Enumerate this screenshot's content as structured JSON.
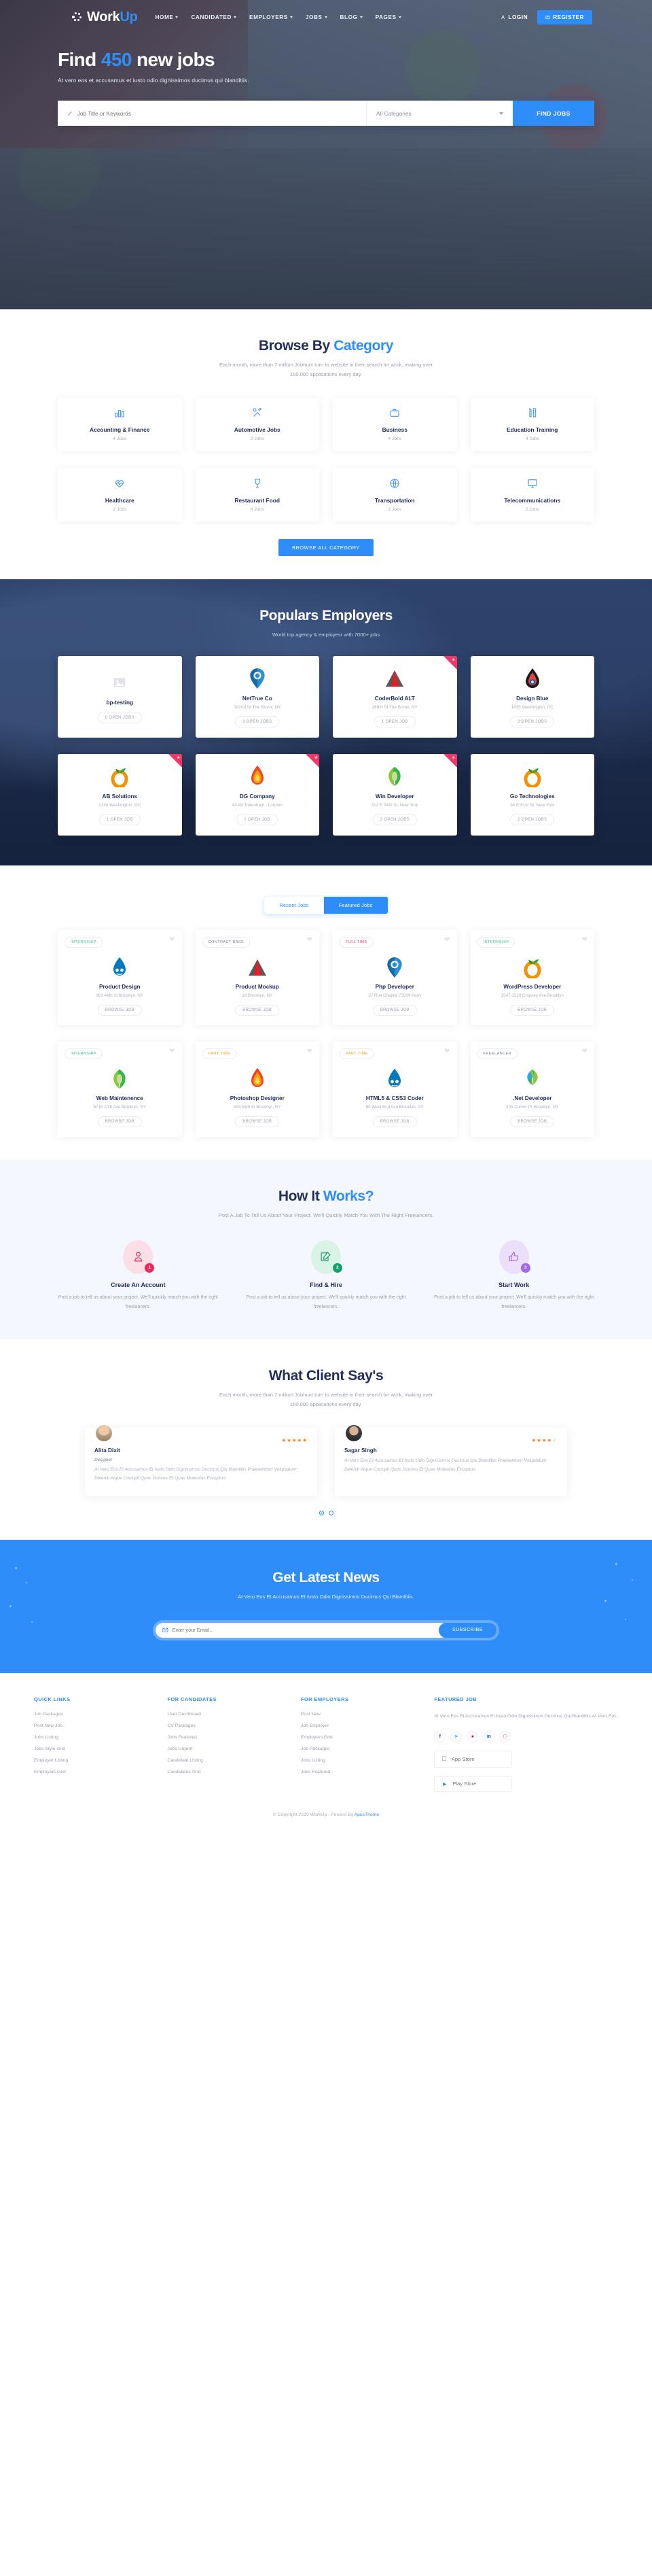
{
  "header": {
    "brand": "Work",
    "brand_accent": "Up",
    "nav": [
      {
        "label": "HOME",
        "caret": true
      },
      {
        "label": "CANDIDATED",
        "caret": true
      },
      {
        "label": "EMPLOYERS",
        "caret": true
      },
      {
        "label": "JOBS",
        "caret": true
      },
      {
        "label": "BLOG",
        "caret": true
      },
      {
        "label": "PAGES",
        "caret": true
      }
    ],
    "login": "LOGIN",
    "register": "REGISTER"
  },
  "hero": {
    "title_pre": "Find ",
    "title_num": "450",
    "title_post": " new jobs",
    "subtitle": "At vero eos et accusamus et iusto odio dignissimos ducimus qui blanditiis.",
    "search_placeholder": "Job Title or Keywords",
    "search_value": "",
    "category_selected": "All Categories",
    "find_button": "FIND JOBS"
  },
  "category": {
    "title_pre": "Browse By ",
    "title_accent": "Category",
    "subtitle_line1": "Each month, more than 7 million Jobhunt turn to website in their search for work, making over",
    "subtitle_line2": "160,000 applications every day.",
    "items": [
      {
        "name": "Accounting & Finance",
        "count": "4 Jobs",
        "icon": "bar-chart-icon"
      },
      {
        "name": "Automotive Jobs",
        "count": "2 Jobs",
        "icon": "tools-icon"
      },
      {
        "name": "Business",
        "count": "4 Jobs",
        "icon": "briefcase-icon"
      },
      {
        "name": "Education Training",
        "count": "4 Jobs",
        "icon": "pencil-ruler-icon"
      },
      {
        "name": "Healthcare",
        "count": "2 Jobs",
        "icon": "heartbeat-icon"
      },
      {
        "name": "Restaurant Food",
        "count": "4 Jobs",
        "icon": "wine-glass-icon"
      },
      {
        "name": "Transportation",
        "count": "2 Jobs",
        "icon": "globe-icon"
      },
      {
        "name": "Telecommunications",
        "count": "2 Jobs",
        "icon": "monitor-icon"
      }
    ],
    "browse_all": "BROWSE ALL CATEGORY"
  },
  "employers": {
    "title": "Populars Employers",
    "subtitle": "World top agency & employesr with 7000+ jobs",
    "items": [
      {
        "name": "bp-testing",
        "address": "",
        "jobs": "0 OPEN JOBS",
        "featured": false,
        "logo": "placeholder-image-icon"
      },
      {
        "name": "NetTrue Co",
        "address": "182nd St The Bronx, NY",
        "jobs": "3 OPEN JOBS",
        "featured": false,
        "logo": "map-pin-logo"
      },
      {
        "name": "CoderBold ALT",
        "address": "188th St The Bronx, NY",
        "jobs": "1 OPEN JOB",
        "featured": true,
        "logo": "triangle-logo"
      },
      {
        "name": "Design Blue",
        "address": "1435 Washington, DC",
        "jobs": "2 OPEN JOBS",
        "featured": false,
        "logo": "droplet-logo"
      },
      {
        "name": "AB Solutions",
        "address": "1334 Washington, DC",
        "jobs": "1 OPEN JOB",
        "featured": true,
        "logo": "orange-leaf-logo"
      },
      {
        "name": "DG Company",
        "address": "43-49 Tottenham , London",
        "jobs": "1 OPEN JOB",
        "featured": true,
        "logo": "flame-logo"
      },
      {
        "name": "Win Developer",
        "address": "312 E 94th St, New York",
        "jobs": "2 OPEN JOBS",
        "featured": true,
        "logo": "green-leaf-logo"
      },
      {
        "name": "Go Technologies",
        "address": "34 E 81st St, New York",
        "jobs": "2 OPEN JOBS",
        "featured": false,
        "logo": "orange-leaf-logo"
      }
    ]
  },
  "jobs": {
    "tabs": [
      {
        "label": "Recent Jobs",
        "active": true
      },
      {
        "label": "Featured Jobs",
        "active": false
      }
    ],
    "browse_label": "BROWSE JOB",
    "items": [
      {
        "tag": "INTERNSHIP",
        "tag_type": "internship",
        "title": "Product Design",
        "address": "803 46th St Brooklyn, NY",
        "logo": "drupal-logo"
      },
      {
        "tag": "CONTRACT BASE",
        "tag_type": "contract",
        "title": "Product Mockup",
        "address": "18 Brooklyn, NY",
        "logo": "triangle-logo"
      },
      {
        "tag": "FULL TIME",
        "tag_type": "fulltime",
        "title": "Php Developer",
        "address": "27 Rue Chaptal 75009 Paris",
        "logo": "map-pin-logo"
      },
      {
        "tag": "INTERNSHIP",
        "tag_type": "internship",
        "title": "WordPress Developer",
        "address": "1547-1519 Cropsey Ave Brooklyn",
        "logo": "orange-leaf-logo"
      },
      {
        "tag": "INTERNSHIP",
        "tag_type": "internship",
        "title": "Web Maintenence",
        "address": "6716 10th Ave Brooklyn, NY",
        "logo": "green-leaf-logo"
      },
      {
        "tag": "PART TIME",
        "tag_type": "parttime",
        "title": "Photoshop Designer",
        "address": "933 55th St Brooklyn, NY",
        "logo": "flame-logo"
      },
      {
        "tag": "PART TIME",
        "tag_type": "parttime",
        "title": "HTML5 & CSS3 Coder",
        "address": "60 West End Ave Brooklyn, NY",
        "logo": "drupal-logo"
      },
      {
        "tag": "FREELANCER",
        "tag_type": "freelancer",
        "title": ".Net Developer",
        "address": "105 Corbin Pl, Brooklyn, NY",
        "logo": "bluegreen-leaf-logo"
      }
    ]
  },
  "how": {
    "title_pre": "How It ",
    "title_accent": "Works?",
    "subtitle": "Post A Job To Tell Us About Your Project. We'll Quickly Match You With The Right Freelancers.",
    "steps": [
      {
        "num": "1",
        "title": "Create An Account",
        "desc": "Post a job to tell us about your project. We'll quickly match you with the right freelancers.",
        "icon": "user-outline-icon",
        "color": "#ef2a5b",
        "bg": "#fbdfe6"
      },
      {
        "num": "2",
        "title": "Find & Hire",
        "desc": "Post a job to tell us about your project. We'll quickly match you with the right freelancers.",
        "icon": "edit-pencil-icon",
        "color": "#18a06a",
        "bg": "#d9f3e7"
      },
      {
        "num": "3",
        "title": "Start Work",
        "desc": "Post a job to tell us about your project. We'll quickly match you with the right freelancers.",
        "icon": "thumbs-up-icon",
        "color": "#a266e8",
        "bg": "#ecdffb"
      }
    ]
  },
  "testimonials": {
    "title": "What Client Say's",
    "subtitle_line1": "Each month, more than 7 million Jobhunt turn to website in their search for work, making over",
    "subtitle_line2": "160,000 applications every day.",
    "items": [
      {
        "name": "Alita Dixit",
        "role": "Designer",
        "text": "At Vero Eos Et Accusamus Et Iusto Odio Dignissimos Ducimus Qui Blanditiis Praesentium Voluptatum Deleniti Atque Corrupti Quos Dolores Et Quas Molestias Excepturi.",
        "rating": 5
      },
      {
        "name": "Sagar Singh",
        "role": "",
        "text": "At Vero Eos Et Accusamus Et Iusto Odio Dignissimos Ducimus Qui Blanditiis Praesentium Voluptatum Deleniti Atque Corrupti Quos Dolores Et Quas Molestias Excepturi.",
        "rating": 4
      }
    ]
  },
  "newsletter": {
    "title": "Get Latest News",
    "subtitle": "At Vero Eos Et Accusamus Et Iusto Odio Dignissimos Ducimus Qui Blanditiis.",
    "placeholder": "Enter your Email..",
    "value": "",
    "button": "SUBSCRIBE"
  },
  "footer": {
    "columns": [
      {
        "heading": "QUICK LINKS",
        "links": [
          "Job Packages",
          "Post New Job",
          "Jobs Listing",
          "Jobs Style Grid",
          "Employer Listing",
          "Employers Grid"
        ]
      },
      {
        "heading": "FOR CANDIDATES",
        "links": [
          "User Dashboard",
          "CV Packages",
          "Jobs Featured",
          "Jobs Urgent",
          "Candidate Listing",
          "Candidates Grid"
        ]
      },
      {
        "heading": "FOR EMPLOYERS",
        "links": [
          "Post New",
          "Job Employer",
          "Employers Grid",
          "Job Packages",
          "Jobs Listing",
          "Jobs Featured"
        ]
      }
    ],
    "featured": {
      "heading": "FEATURED JOB",
      "text": "At Vero Eos Et Accusamus Et Iusto Odio Dignissimos Ducimus Qui Blanditiis.At Vero Eos.",
      "socials": [
        "facebook-icon",
        "twitter-icon",
        "pinterest-icon",
        "linkedin-icon",
        "instagram-icon"
      ],
      "app_store": "App Store",
      "play_store": "Play Store"
    },
    "copyright_pre": "© Copyright 2019 WorkUp - Powerd By ",
    "copyright_link": "ApusTheme"
  }
}
